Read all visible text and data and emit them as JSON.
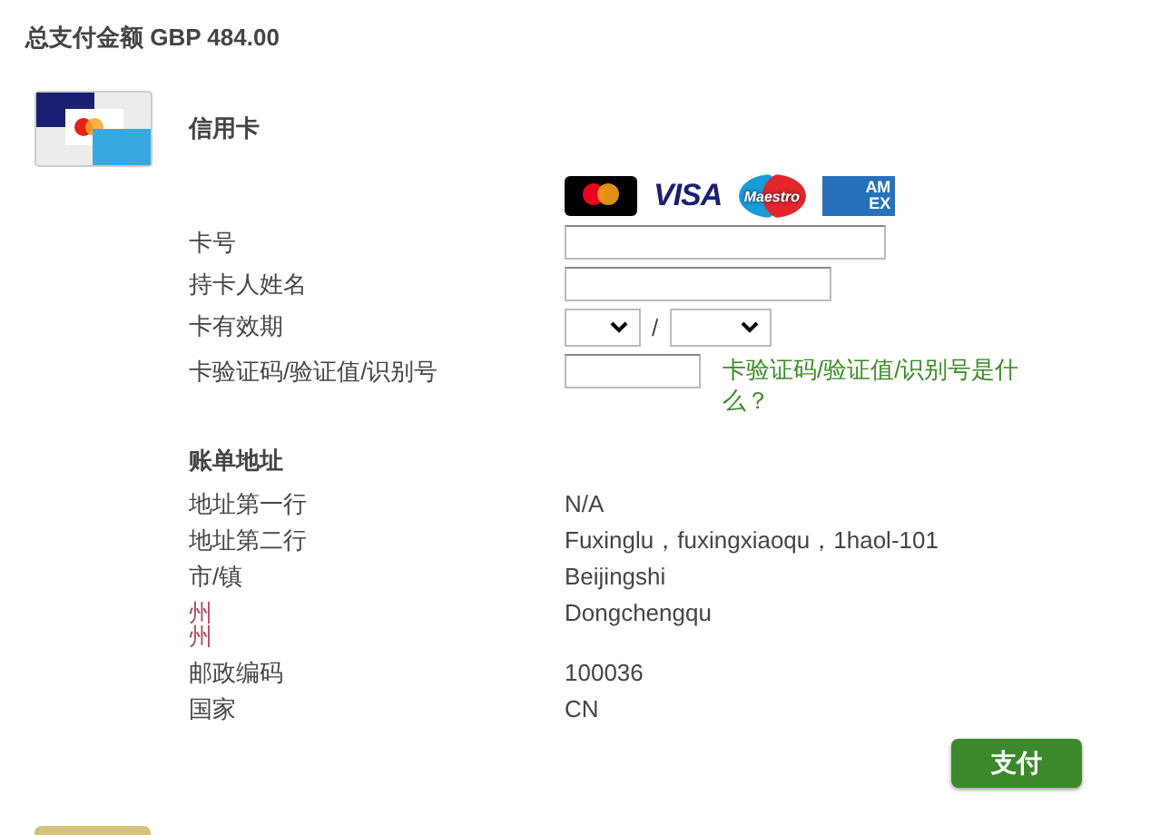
{
  "total": "总支付金额 GBP 484.00",
  "method": {
    "title": "信用卡"
  },
  "card_logos": [
    {
      "kind": "mastercard"
    },
    {
      "kind": "visa",
      "text": "VISA"
    },
    {
      "kind": "maestro",
      "text": "Maestro"
    },
    {
      "kind": "amex",
      "text": "AM EX"
    }
  ],
  "card_form": [
    {
      "kind": "long_input",
      "label": "卡号"
    },
    {
      "kind": "medium_input",
      "label": "持卡人姓名"
    },
    {
      "kind": "expiry",
      "label": "卡有效期",
      "separator": "/"
    },
    {
      "kind": "cvv",
      "label": "卡验证码/验证值/识别号",
      "link": "卡验证码/验证值/识别号是什么？"
    }
  ],
  "billing": {
    "title": "账单地址",
    "rows": [
      {
        "labels": [
          "地址第一行"
        ],
        "value": "N/A",
        "flagged": false
      },
      {
        "labels": [
          "地址第二行"
        ],
        "value": "Fuxinglu，fuxingxiaoqu，1haol-101",
        "flagged": false
      },
      {
        "labels": [
          "市/镇"
        ],
        "value": "Beijingshi",
        "flagged": false
      },
      {
        "labels": [
          "州",
          "州"
        ],
        "value": "Dongchengqu",
        "flagged": true
      },
      {
        "labels": [
          "邮政编码"
        ],
        "value": "100036",
        "flagged": false
      },
      {
        "labels": [
          "国家"
        ],
        "value": "CN",
        "flagged": false
      }
    ]
  },
  "pay_button": "支付"
}
